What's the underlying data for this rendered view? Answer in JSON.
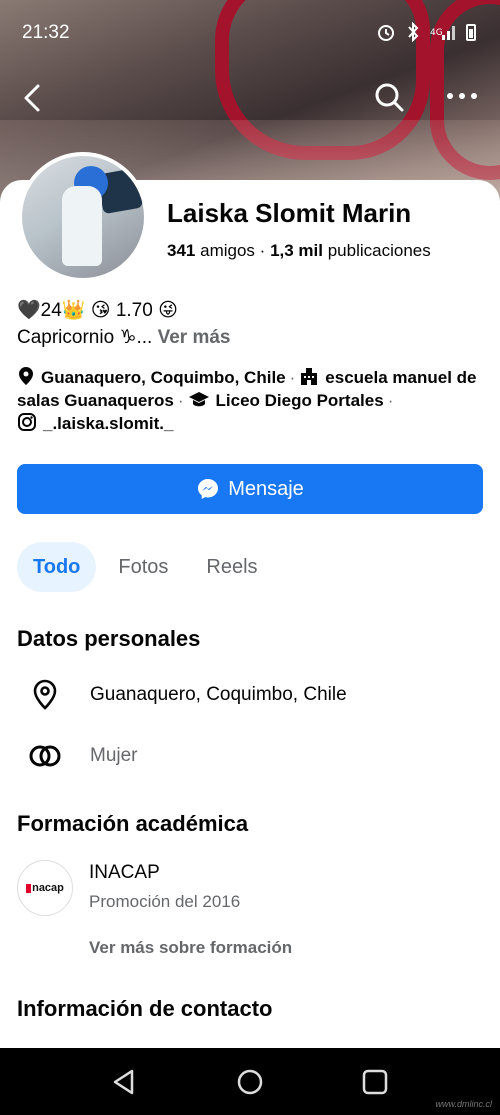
{
  "status_bar": {
    "time": "21:32"
  },
  "profile": {
    "name": "Laiska Slomit Marin",
    "friends_count": "341",
    "friends_label": "amigos",
    "separator": "·",
    "posts_count": "1,3 mil",
    "posts_label": "publicaciones"
  },
  "bio": {
    "line1": "🖤24👑 😘 1.70 😜",
    "line2": "Capricornio ♑...",
    "see_more": "Ver más"
  },
  "details": {
    "location": "Guanaquero, Coquimbo, Chile",
    "school1": "escuela manuel de salas Guanaqueros",
    "school2": "Liceo Diego Portales",
    "instagram": "_.laiska.slomit._"
  },
  "message_button": {
    "label": "Mensaje"
  },
  "tabs": [
    {
      "label": "Todo",
      "active": true
    },
    {
      "label": "Fotos",
      "active": false
    },
    {
      "label": "Reels",
      "active": false
    }
  ],
  "personal": {
    "title": "Datos personales",
    "location": "Guanaquero, Coquimbo, Chile",
    "gender": "Mujer"
  },
  "education": {
    "title": "Formación académica",
    "school": "INACAP",
    "logo_text": "nacap",
    "promo": "Promoción del 2016",
    "see_more": "Ver más sobre formación"
  },
  "contact": {
    "title": "Información de contacto"
  },
  "watermark": "www.dmlinc.cl",
  "colors": {
    "accent": "#1877f2",
    "accent_light": "#e7f3ff",
    "muted": "#65676b"
  }
}
